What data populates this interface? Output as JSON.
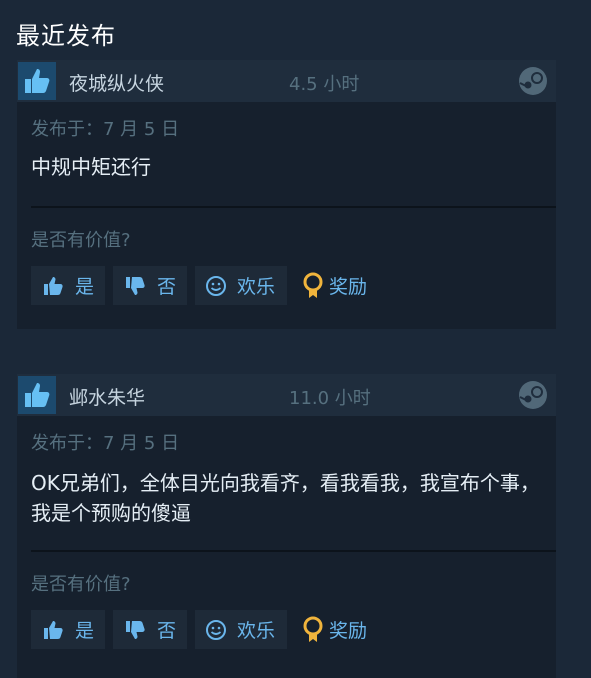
{
  "section_title": "最近发布",
  "reviews": [
    {
      "author": "夜城纵火侠",
      "hours": "4.5 小时",
      "posted": "发布于：7 月 5 日",
      "content": "中规中矩还行",
      "helpful_question": "是否有价值?",
      "yes_label": "是",
      "no_label": "否",
      "funny_label": "欢乐",
      "award_label": "奖励"
    },
    {
      "author": "邺水朱华",
      "hours": "11.0 小时",
      "posted": "发布于：7 月 5 日",
      "content": "OK兄弟们，全体目光向我看齐，看我看我，我宣布个事，我是个预购的傻逼",
      "helpful_question": "是否有价值?",
      "yes_label": "是",
      "no_label": "否",
      "funny_label": "欢乐",
      "award_label": "奖励"
    }
  ],
  "colors": {
    "background": "#1b2838",
    "card": "#16202d",
    "accent": "#6ab6ec",
    "thumb_up": "#66c0f4",
    "award": "#f0b43c"
  },
  "icons": [
    "thumbs-up-icon",
    "thumbs-down-icon",
    "smiley-icon",
    "award-icon",
    "steam-logo-icon"
  ]
}
